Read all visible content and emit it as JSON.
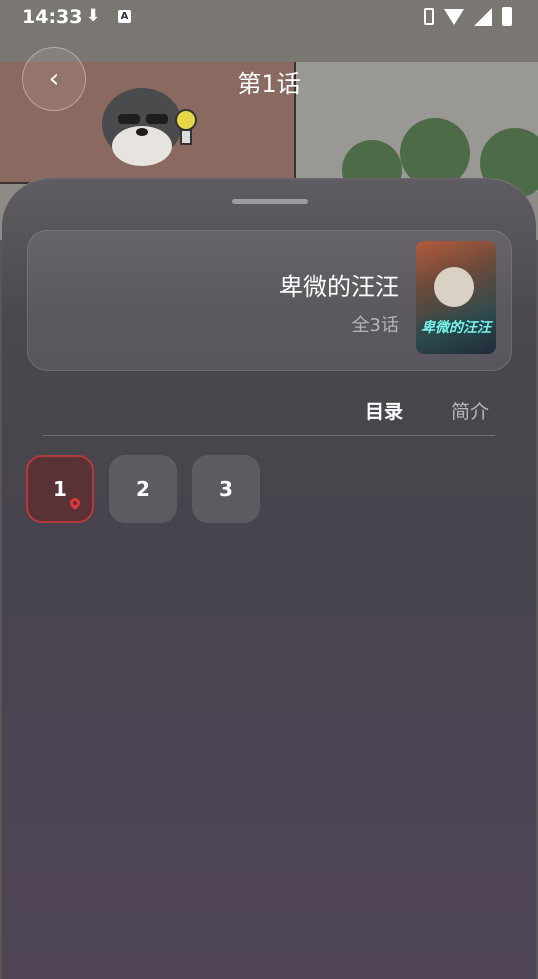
{
  "status_bar": {
    "time": "14:33"
  },
  "header": {
    "title": "第1话",
    "back_icon": "‹"
  },
  "book": {
    "title": "卑微的汪汪",
    "count": "全3话",
    "cover_text": "卑微的汪汪"
  },
  "tabs": [
    {
      "label": "目录",
      "active": true
    },
    {
      "label": "简介",
      "active": false
    }
  ],
  "chapters": [
    {
      "label": "1",
      "current": true
    },
    {
      "label": "2",
      "current": false
    },
    {
      "label": "3",
      "current": false
    }
  ],
  "colors": {
    "accent": "#e2373d",
    "current_border": "#b03a3e"
  }
}
